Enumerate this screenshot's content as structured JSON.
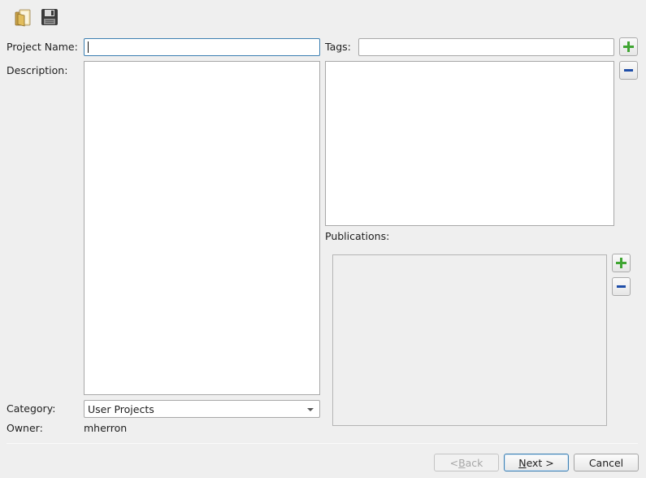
{
  "toolbar": {
    "open_icon": "folder-open-icon",
    "save_icon": "floppy-save-icon"
  },
  "form": {
    "project_name_label": "Project Name:",
    "project_name_value": "",
    "description_label": "Description:",
    "description_value": "",
    "tags_label": "Tags:",
    "tags_value": "",
    "publications_label": "Publications:",
    "category_label": "Category:",
    "category_value": "User Projects",
    "owner_label": "Owner:",
    "owner_value": "mherron"
  },
  "icons": {
    "add": "plus-icon",
    "remove": "minus-icon"
  },
  "buttons": {
    "back": {
      "prefix": "< ",
      "mnemonic": "B",
      "rest": "ack"
    },
    "next": {
      "prefix": "",
      "mnemonic": "N",
      "rest": "ext >"
    },
    "cancel": "Cancel"
  },
  "colors": {
    "add_green": "#3fa532",
    "remove_blue": "#1f4ea8",
    "focus_border": "#3c7fb1"
  }
}
